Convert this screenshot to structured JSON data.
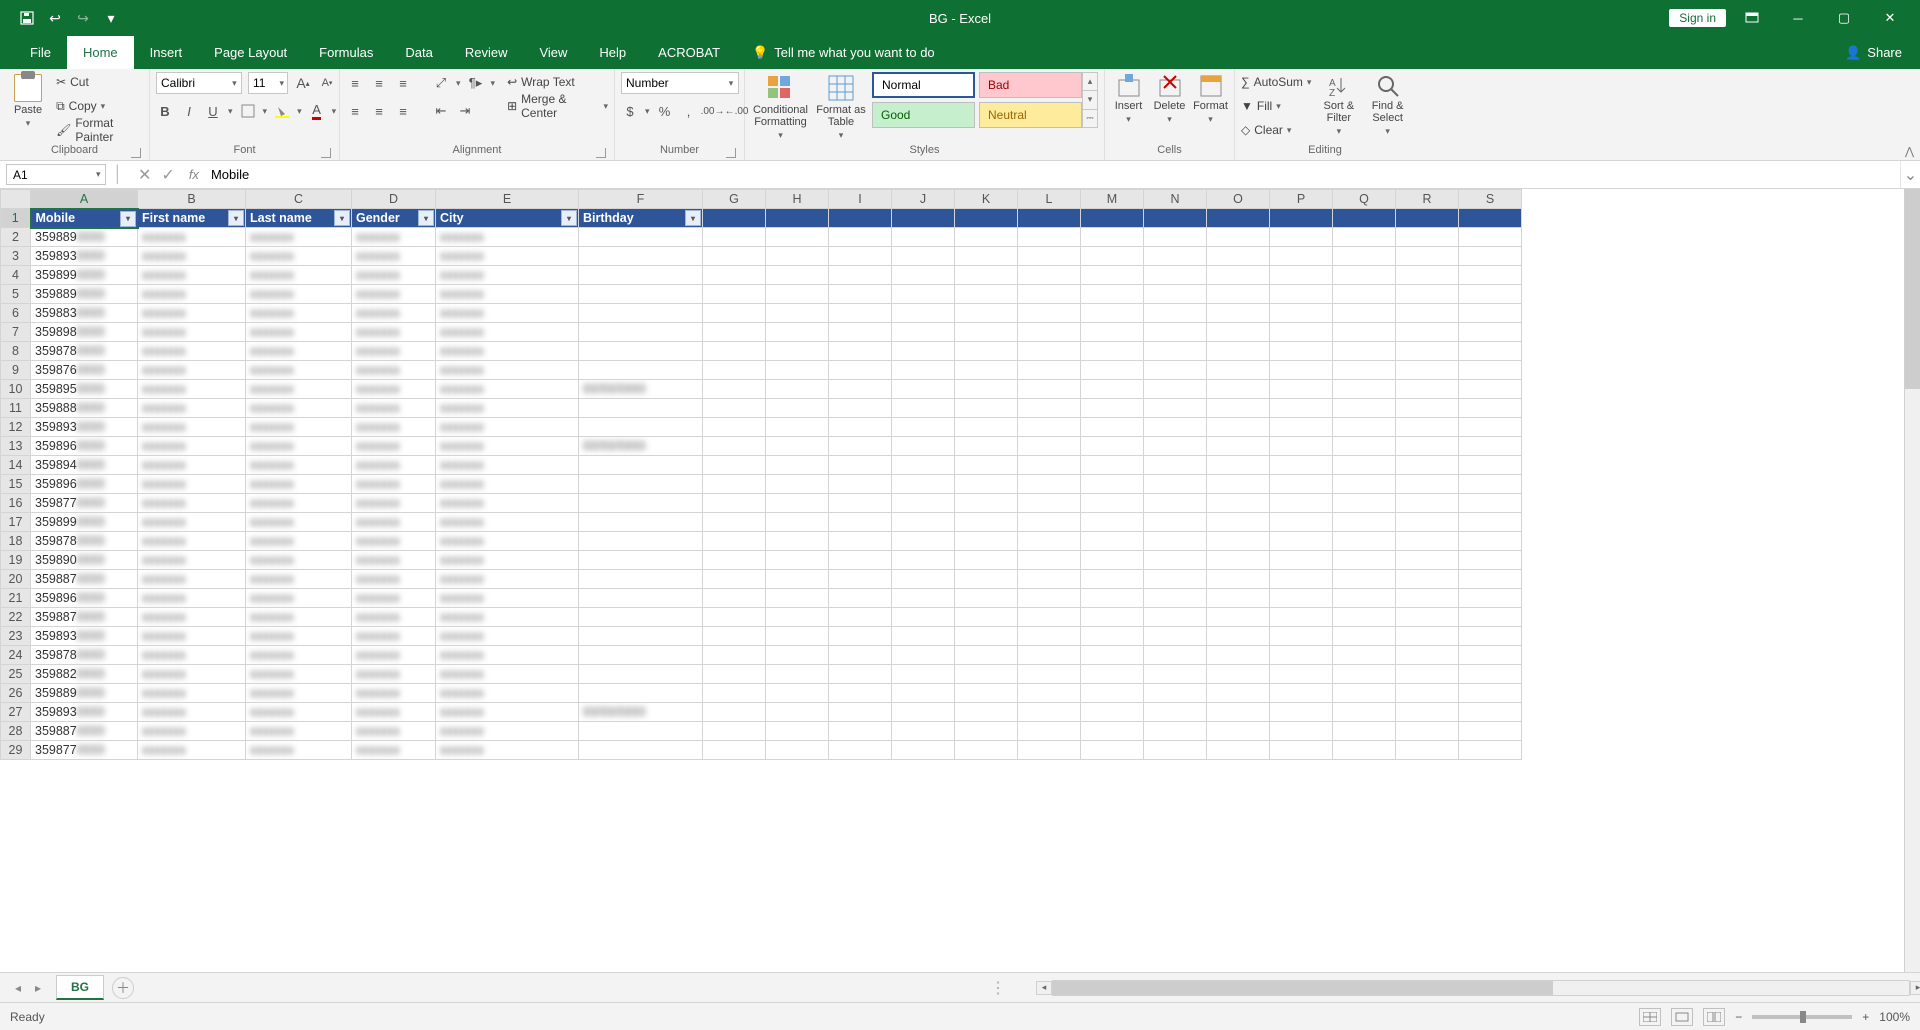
{
  "title": "BG  -  Excel",
  "signin": "Sign in",
  "share": "Share",
  "tabs": {
    "file": "File",
    "home": "Home",
    "insert": "Insert",
    "pagelayout": "Page Layout",
    "formulas": "Formulas",
    "data": "Data",
    "review": "Review",
    "view": "View",
    "help": "Help",
    "acrobat": "ACROBAT",
    "tellme": "Tell me what you want to do"
  },
  "ribbon": {
    "clipboard": {
      "label": "Clipboard",
      "paste": "Paste",
      "cut": "Cut",
      "copy": "Copy",
      "fp": "Format Painter"
    },
    "font": {
      "label": "Font",
      "name": "Calibri",
      "size": "11"
    },
    "alignment": {
      "label": "Alignment",
      "wrap": "Wrap Text",
      "merge": "Merge & Center"
    },
    "number": {
      "label": "Number",
      "format": "Number"
    },
    "styles": {
      "label": "Styles",
      "cond": "Conditional Formatting",
      "fat": "Format as Table",
      "normal": "Normal",
      "bad": "Bad",
      "good": "Good",
      "neutral": "Neutral"
    },
    "cells": {
      "label": "Cells",
      "insert": "Insert",
      "delete": "Delete",
      "format": "Format"
    },
    "editing": {
      "label": "Editing",
      "autosum": "AutoSum",
      "fill": "Fill",
      "clear": "Clear",
      "sort": "Sort & Filter",
      "find": "Find & Select"
    }
  },
  "namebox": "A1",
  "formula": "Mobile",
  "columns": [
    "A",
    "B",
    "C",
    "D",
    "E",
    "F",
    "G",
    "H",
    "I",
    "J",
    "K",
    "L",
    "M",
    "N",
    "O",
    "P",
    "Q",
    "R",
    "S"
  ],
  "headers": {
    "A": "Mobile",
    "B": "First name",
    "C": "Last name",
    "D": "Gender",
    "E": "City",
    "F": "Birthday"
  },
  "rows": [
    {
      "n": 2,
      "a": "359889"
    },
    {
      "n": 3,
      "a": "359893"
    },
    {
      "n": 4,
      "a": "359899"
    },
    {
      "n": 5,
      "a": "359889"
    },
    {
      "n": 6,
      "a": "359883"
    },
    {
      "n": 7,
      "a": "359898"
    },
    {
      "n": 8,
      "a": "359878"
    },
    {
      "n": 9,
      "a": "359876"
    },
    {
      "n": 10,
      "a": "359895"
    },
    {
      "n": 11,
      "a": "359888"
    },
    {
      "n": 12,
      "a": "359893"
    },
    {
      "n": 13,
      "a": "359896"
    },
    {
      "n": 14,
      "a": "359894"
    },
    {
      "n": 15,
      "a": "359896"
    },
    {
      "n": 16,
      "a": "359877"
    },
    {
      "n": 17,
      "a": "359899"
    },
    {
      "n": 18,
      "a": "359878"
    },
    {
      "n": 19,
      "a": "359890"
    },
    {
      "n": 20,
      "a": "359887"
    },
    {
      "n": 21,
      "a": "359896"
    },
    {
      "n": 22,
      "a": "359887"
    },
    {
      "n": 23,
      "a": "359893"
    },
    {
      "n": 24,
      "a": "359878"
    },
    {
      "n": 25,
      "a": "359882"
    },
    {
      "n": 26,
      "a": "359889"
    },
    {
      "n": 27,
      "a": "359893"
    },
    {
      "n": 28,
      "a": "359887"
    },
    {
      "n": 29,
      "a": "359877"
    }
  ],
  "sheet": "BG",
  "status": "Ready",
  "zoom": "100%"
}
